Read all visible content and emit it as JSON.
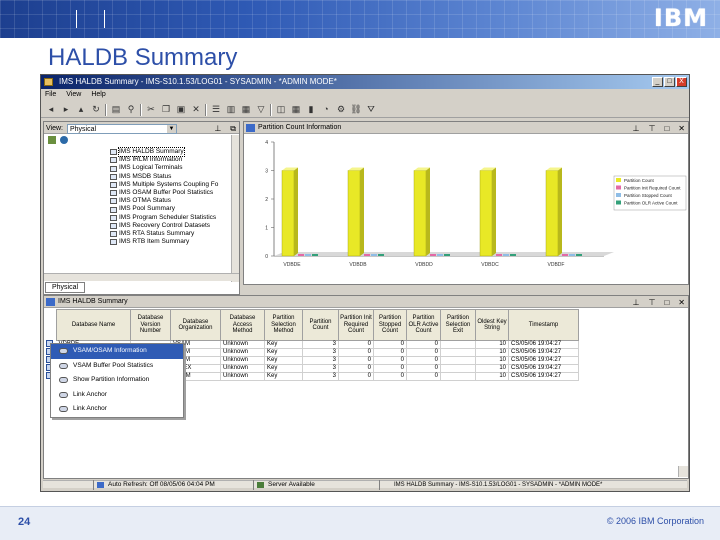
{
  "slide": {
    "title": "HALDB Summary",
    "logo": "IBM",
    "page_number": "24",
    "copyright": "© 2006 IBM Corporation"
  },
  "window": {
    "title": "IMS HALDB Summary - IMS-S10.1.53/LOG01 - SYSADMIN - *ADMIN MODE*",
    "menu": [
      "File",
      "View",
      "Help"
    ],
    "controls": [
      "_",
      "□",
      "X"
    ]
  },
  "navigator": {
    "view_label": "View:",
    "view_value": "Physical",
    "tree_items": [
      "IMS HALDB Summary",
      "IMS IRLM Information",
      "IMS Logical Terminals",
      "IMS MSDB Status",
      "IMS Multiple Systems Coupling Fo",
      "IMS OSAM Buffer Pool Statistics",
      "IMS OTMA Status",
      "IMS Pool Summary",
      "IMS Program Scheduler Statistics",
      "IMS Recovery Control Datasets",
      "IMS RTA Status Summary",
      "IMS RTB Item Summary"
    ],
    "tab_label": "Physical"
  },
  "chart_panel": {
    "title": "Partition Count Information"
  },
  "chart_data": {
    "type": "bar",
    "categories": [
      "VDBDE",
      "VDBDB",
      "VDBDD",
      "VDBDC",
      "VDBDF"
    ],
    "series": [
      {
        "name": "Partition Count",
        "values": [
          3,
          3,
          3,
          3,
          3
        ],
        "color": "#e8e826"
      },
      {
        "name": "Partition Init Required Count",
        "values": [
          0,
          0,
          0,
          0,
          0
        ],
        "color": "#e36aa6"
      },
      {
        "name": "Partition Stopped Count",
        "values": [
          0,
          0,
          0,
          0,
          0
        ],
        "color": "#8fbde6"
      },
      {
        "name": "Partition OLR Active Count",
        "values": [
          0,
          0,
          0,
          0,
          0
        ],
        "color": "#33a07a"
      }
    ],
    "ylim": [
      0,
      4
    ],
    "yticks": [
      "4",
      "3",
      "2",
      "1",
      "0"
    ],
    "legend_position": "right"
  },
  "table_panel": {
    "title": "IMS HALDB Summary",
    "columns": [
      "Database Name",
      "Database Version Number",
      "Database Organization",
      "Database Access Method",
      "Partition Selection Method",
      "Partition Count",
      "Partition Init Required Count",
      "Partition Stopped Count",
      "Partition OLR Active Count",
      "Partition Selection Exit",
      "Oldest Key String",
      "Timestamp"
    ],
    "rows": [
      [
        "VDBDE",
        "",
        "",
        "VSAM",
        "Unknown",
        "Key",
        "3",
        "0",
        "0",
        "0",
        "",
        "10",
        "CS/05/06 19:04:27"
      ],
      [
        "VDBDB",
        "",
        "",
        "VSAM",
        "Unknown",
        "Key",
        "3",
        "0",
        "0",
        "0",
        "",
        "10",
        "CS/05/06 19:04:27"
      ],
      [
        "VDBDD",
        "",
        "",
        "VSAM",
        "Unknown",
        "Key",
        "3",
        "0",
        "0",
        "0",
        "",
        "10",
        "CS/05/06 19:04:27"
      ],
      [
        "VDBDC",
        "",
        "",
        "INDEX",
        "Unknown",
        "Key",
        "3",
        "0",
        "0",
        "0",
        "",
        "10",
        "CS/05/06 19:04:27"
      ],
      [
        "VDBDF",
        "",
        "",
        "OSAM",
        "Unknown",
        "Key",
        "3",
        "0",
        "0",
        "0",
        "",
        "10",
        "CS/05/06 19:04:27"
      ]
    ]
  },
  "context_menu": {
    "items": [
      "VSAM/OSAM Information",
      "VSAM Buffer Pool Statistics",
      "Show Partition Information",
      "Link Anchor",
      "Link Anchor"
    ]
  },
  "statusbar": {
    "refresh": "Auto Refresh: Off   08/05/06 04:04 PM",
    "server": "Server Available",
    "context": "IMS HALDB Summary - IMS-S10.1.53/LOG01 - SYSADMIN - *ADMIN MODE*"
  }
}
